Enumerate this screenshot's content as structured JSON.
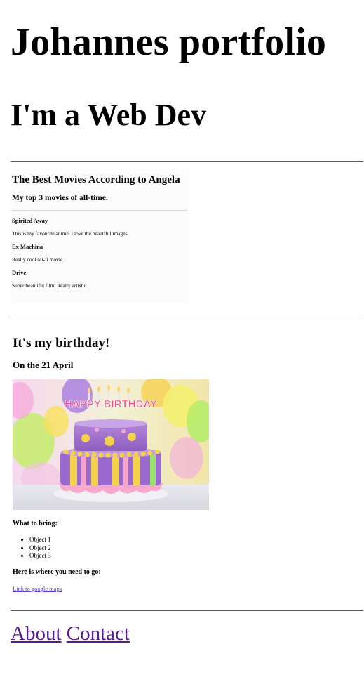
{
  "header": {
    "title": "Johannes portfolio",
    "subtitle": "I'm a Web Dev"
  },
  "movies": {
    "title": "The Best Movies According to Angela",
    "subtitle": "My top 3 movies of all-time.",
    "items": [
      {
        "name": "Spirited Away",
        "description": "This is my favourite anime. I love the beautiful images."
      },
      {
        "name": "Ex Machina",
        "description": "Really cool sci-fi movie."
      },
      {
        "name": "Drive",
        "description": "Super beautiful film. Really artistic."
      }
    ]
  },
  "birthday": {
    "title": "It's my birthday!",
    "date": "On the 21 April",
    "cake_text": "HAPPY BIRTHDAY",
    "bring_title": "What to bring:",
    "bring_items": [
      "Object 1",
      "Object 2",
      "Object 3"
    ],
    "where_title": "Here is where you need to go:",
    "map_link": "Link to google maps"
  },
  "nav": {
    "about": "About",
    "contact": "Contact"
  },
  "colors": {
    "visited_link": "#551a8b",
    "link": "#5b3fd6",
    "rule": "#5a5a5a"
  }
}
